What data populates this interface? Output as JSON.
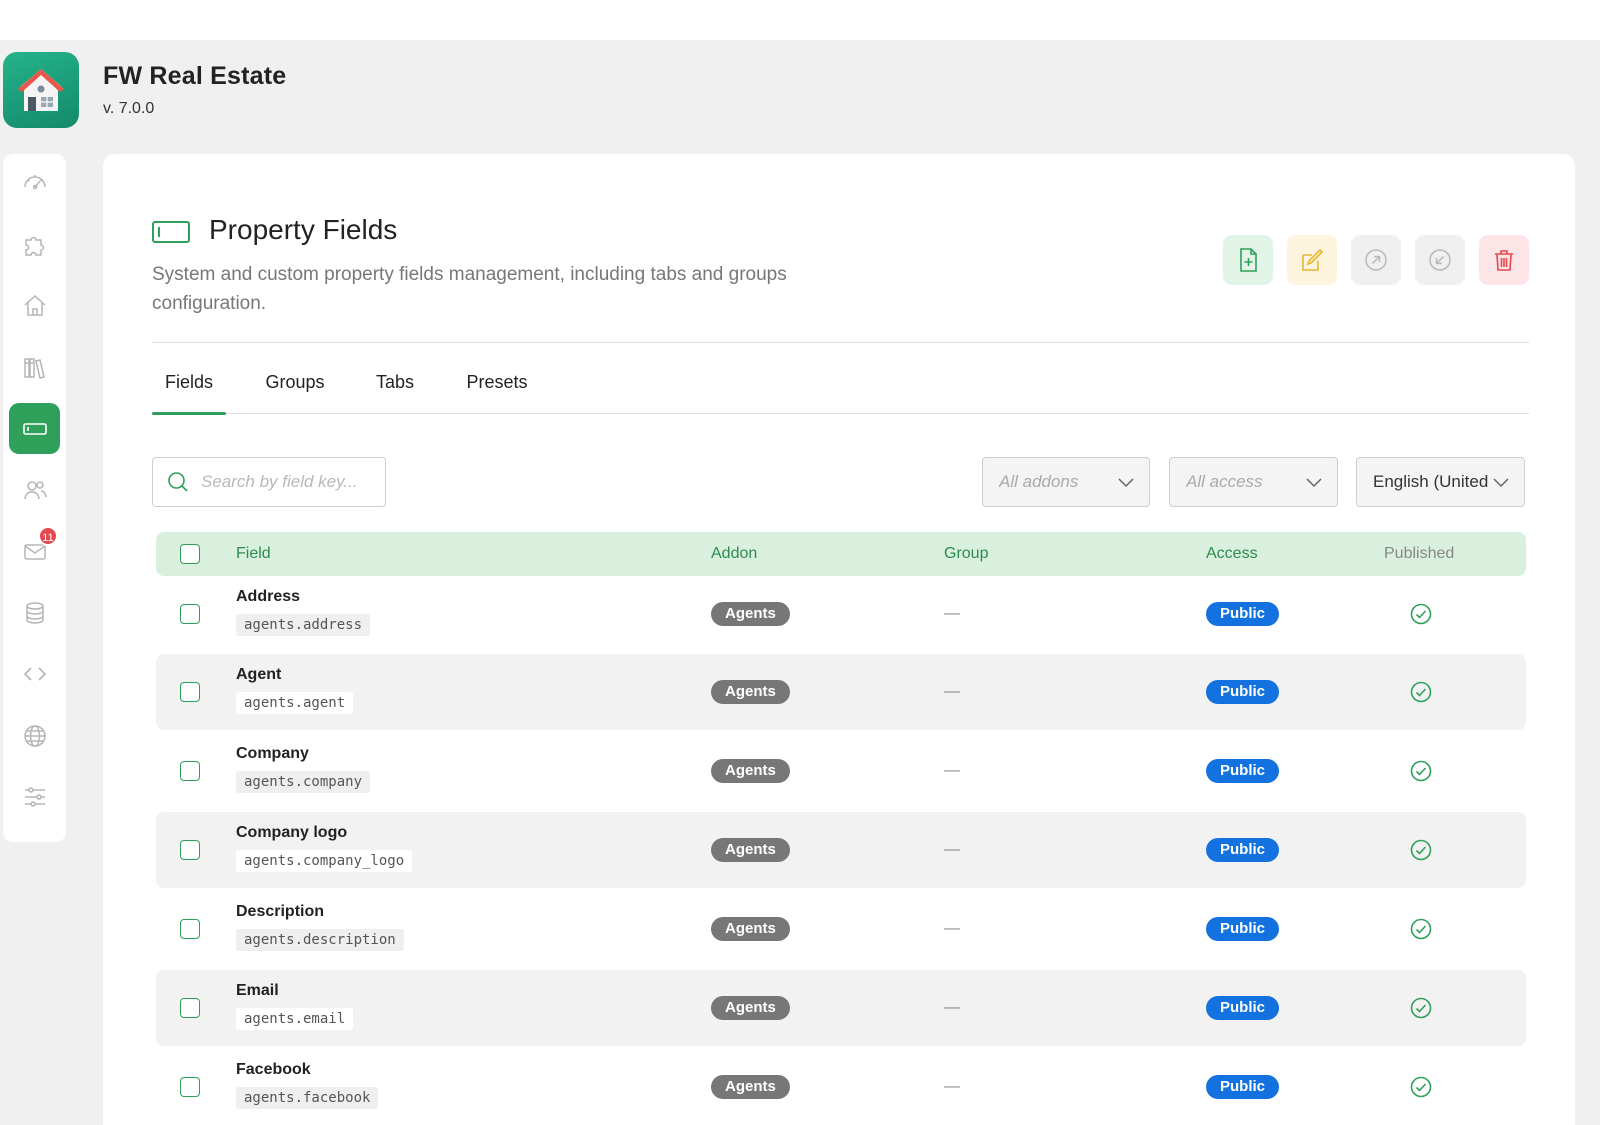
{
  "app": {
    "title": "FW Real Estate",
    "version": "v. 7.0.0",
    "logo_icon": "house-logo-icon",
    "brand_color": "#1aa07a"
  },
  "sidebar": {
    "accent_color": "#2ea05a",
    "items": [
      {
        "icon": "dashboard-gauge-icon",
        "active": false
      },
      {
        "icon": "puzzle-icon",
        "active": false
      },
      {
        "icon": "home-icon",
        "active": false
      },
      {
        "icon": "library-icon",
        "active": false
      },
      {
        "icon": "field-input-icon",
        "active": true
      },
      {
        "icon": "users-icon",
        "active": false
      },
      {
        "icon": "mail-icon",
        "active": false,
        "badge": "11"
      },
      {
        "icon": "database-icon",
        "active": false
      },
      {
        "icon": "code-icon",
        "active": false
      },
      {
        "icon": "globe-icon",
        "active": false
      },
      {
        "icon": "sliders-icon",
        "active": false
      }
    ]
  },
  "page": {
    "title": "Property Fields",
    "description": "System and custom property fields management, including tabs and groups configuration."
  },
  "actions": {
    "add_icon": "file-add-icon",
    "edit_icon": "edit-icon",
    "export_icon": "export-arrow-icon",
    "import_icon": "import-arrow-icon",
    "delete_icon": "trash-icon"
  },
  "tabs": [
    {
      "label": "Fields",
      "active": true
    },
    {
      "label": "Groups",
      "active": false
    },
    {
      "label": "Tabs",
      "active": false
    },
    {
      "label": "Presets",
      "active": false
    }
  ],
  "filters": {
    "search_placeholder": "Search by field key...",
    "addons_placeholder": "All addons",
    "access_placeholder": "All access",
    "language_value": "English (United States)"
  },
  "table": {
    "headers": {
      "field": "Field",
      "addon": "Addon",
      "group": "Group",
      "access": "Access",
      "published": "Published"
    },
    "rows": [
      {
        "name": "Address",
        "key": "agents.address",
        "addon": "Agents",
        "group": "—",
        "access": "Public",
        "published": true
      },
      {
        "name": "Agent",
        "key": "agents.agent",
        "addon": "Agents",
        "group": "—",
        "access": "Public",
        "published": true
      },
      {
        "name": "Company",
        "key": "agents.company",
        "addon": "Agents",
        "group": "—",
        "access": "Public",
        "published": true
      },
      {
        "name": "Company logo",
        "key": "agents.company_logo",
        "addon": "Agents",
        "group": "—",
        "access": "Public",
        "published": true
      },
      {
        "name": "Description",
        "key": "agents.description",
        "addon": "Agents",
        "group": "—",
        "access": "Public",
        "published": true
      },
      {
        "name": "Email",
        "key": "agents.email",
        "addon": "Agents",
        "group": "—",
        "access": "Public",
        "published": true
      },
      {
        "name": "Facebook",
        "key": "agents.facebook",
        "addon": "Agents",
        "group": "—",
        "access": "Public",
        "published": true
      }
    ]
  },
  "colors": {
    "header_bg": "#d8f0dd",
    "header_text": "#2e8b4f",
    "addon_pill": "#777777",
    "access_pill": "#1372e0",
    "published_check": "#2ea05a"
  }
}
